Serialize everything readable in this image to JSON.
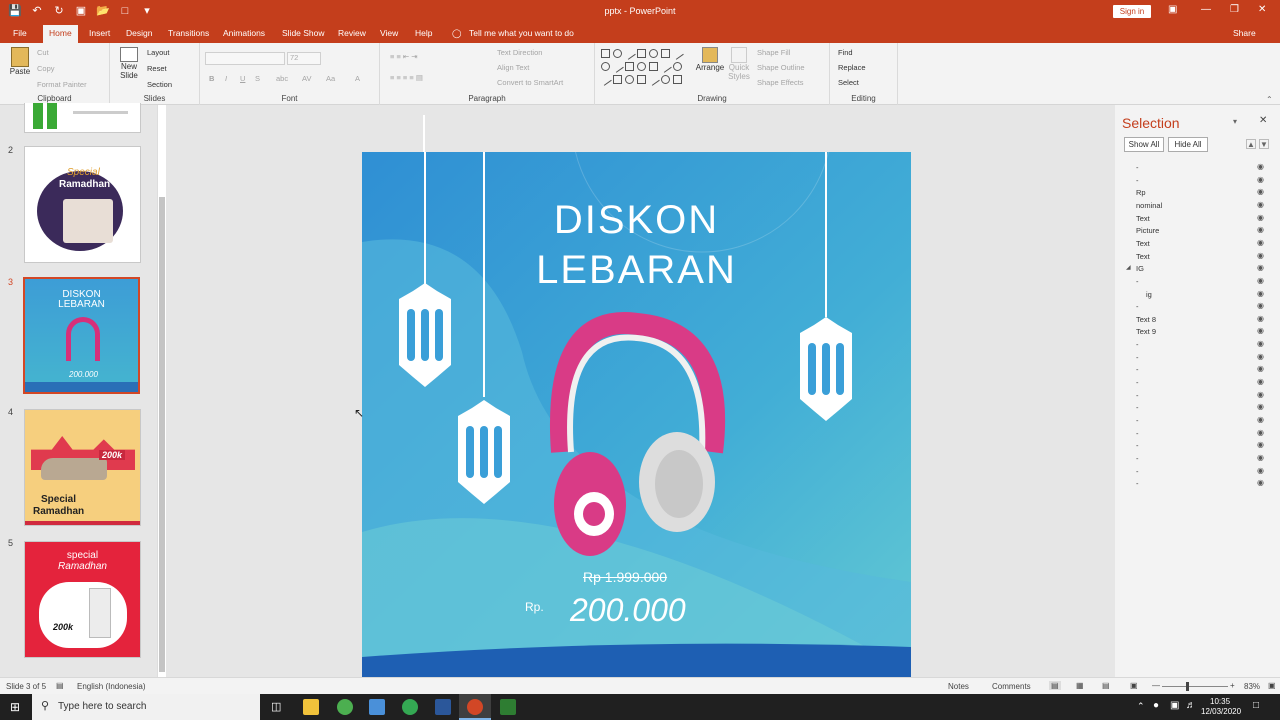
{
  "window": {
    "title": "pptx - PowerPoint",
    "signin": "Sign in",
    "share": "Share"
  },
  "tabs": [
    "File",
    "Home",
    "Insert",
    "Design",
    "Transitions",
    "Animations",
    "Slide Show",
    "Review",
    "View",
    "Help"
  ],
  "tell_me": "Tell me what you want to do",
  "ribbon": {
    "clipboard": {
      "label": "Clipboard",
      "paste": "Paste",
      "cut": "Cut",
      "copy": "Copy",
      "format_painter": "Format Painter"
    },
    "slides": {
      "label": "Slides",
      "new_slide": "New Slide",
      "layout": "Layout",
      "reset": "Reset",
      "section": "Section"
    },
    "font": {
      "label": "Font",
      "size": "72",
      "bold": "B",
      "italic": "I",
      "underline": "U",
      "strike": "S",
      "shadow": "abc",
      "spacing": "AV",
      "case": "Aa",
      "color": "A"
    },
    "paragraph": {
      "label": "Paragraph",
      "text_direction": "Text Direction",
      "align_text": "Align Text",
      "smartart": "Convert to SmartArt"
    },
    "drawing": {
      "label": "Drawing",
      "arrange": "Arrange",
      "quick_styles": "Quick Styles",
      "shape_fill": "Shape Fill",
      "shape_outline": "Shape Outline",
      "shape_effects": "Shape Effects"
    },
    "editing": {
      "label": "Editing",
      "find": "Find",
      "replace": "Replace",
      "select": "Select"
    }
  },
  "thumbnails": [
    {
      "num": "2",
      "title": "Special",
      "subtitle": "Ramadhan"
    },
    {
      "num": "3",
      "title": "DISKON",
      "subtitle": "LEBARAN",
      "price": "200.000"
    },
    {
      "num": "4",
      "price": "200k",
      "title": "Special",
      "subtitle": "Ramadhan"
    },
    {
      "num": "5",
      "title": "special",
      "subtitle": "Ramadhan",
      "price": "200k"
    }
  ],
  "slide": {
    "title_line1": "DISKON",
    "title_line2": "LEBARAN",
    "old_price": "Rp 1.999.000",
    "currency": "Rp.",
    "new_price": "200.000"
  },
  "selection_pane": {
    "title": "Selection",
    "show_all": "Show All",
    "hide_all": "Hide All",
    "items": [
      "-",
      "-",
      "Rp",
      "nominal",
      "Text",
      "Picture",
      "Text",
      "Text",
      "IG",
      "-",
      "ig",
      "-",
      "Text 8",
      "Text 9",
      "-",
      "-",
      "-",
      "-",
      "-",
      "-",
      "-",
      "-",
      "-",
      "-",
      "-",
      "-"
    ]
  },
  "status": {
    "slide": "Slide 3 of 5",
    "language": "English (Indonesia)",
    "notes": "Notes",
    "comments": "Comments",
    "zoom": "83%"
  },
  "taskbar": {
    "search": "Type here to search",
    "time": "10:35",
    "date": "12/03/2020"
  }
}
